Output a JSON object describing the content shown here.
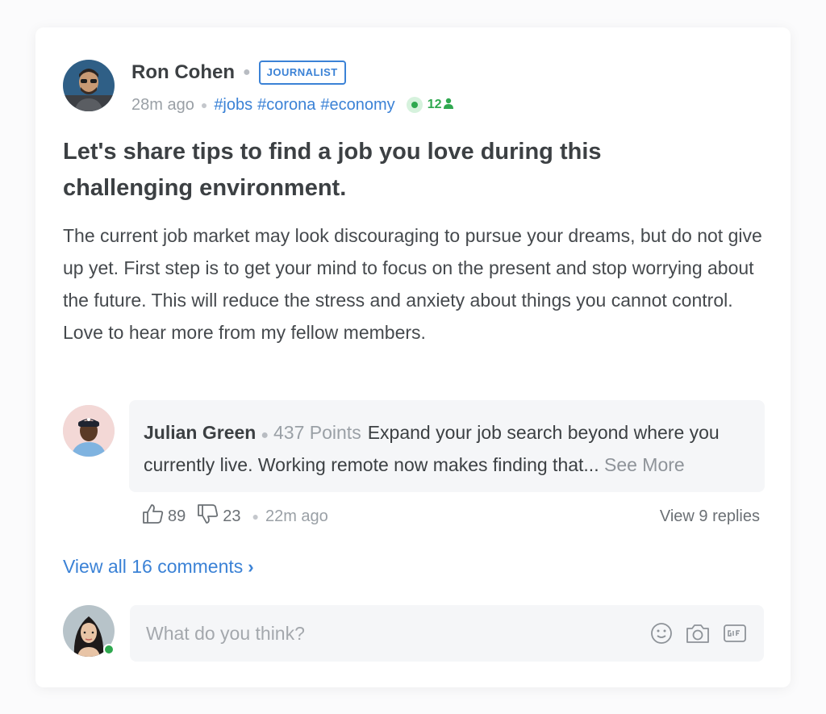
{
  "post": {
    "author": "Ron Cohen",
    "badge": "JOURNALIST",
    "time": "28m ago",
    "tags": [
      "#jobs",
      "#corona",
      "#economy"
    ],
    "online_count": "12",
    "title": "Let's share tips to find a job you love during this challenging environment.",
    "body": "The current job market may look discouraging to pursue your dreams, but do not give up yet. First step is to get your mind to focus on the present and stop worrying about the future. This will reduce the stress and anxiety about things you cannot control. Love to hear more from my fellow members."
  },
  "comment": {
    "author": "Julian Green",
    "points": "437 Points",
    "text": "Expand your job search beyond where you currently live. Working remote now makes finding that...",
    "see_more": "See More",
    "likes": "89",
    "dislikes": "23",
    "time": "22m ago",
    "view_replies": "View 9 replies"
  },
  "view_all_comments": "View all 16 comments",
  "composer": {
    "placeholder": "What do you think?",
    "icons": [
      "smiley-icon",
      "camera-icon",
      "gif-icon"
    ]
  },
  "colors": {
    "accent": "#3b82d6",
    "online": "#2fa84f",
    "muted": "#9aa0a6"
  }
}
